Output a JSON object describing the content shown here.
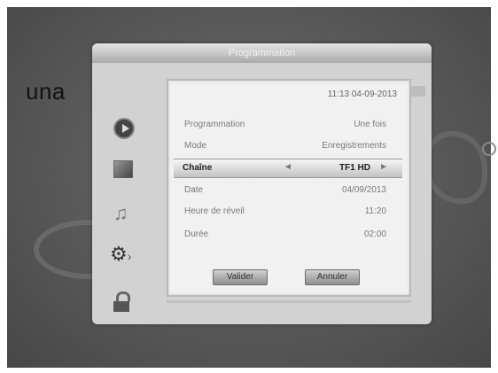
{
  "overlay_text": "una",
  "window": {
    "title": "Programmation"
  },
  "sidebar": {
    "icons": [
      "play-icon",
      "picture-icon",
      "music-icon",
      "tools-icon",
      "lock-icon"
    ]
  },
  "panel": {
    "datetime": "11:13 04-09-2013",
    "rows": [
      {
        "label": "Programmation",
        "value": "Une fois"
      },
      {
        "label": "Mode",
        "value": "Enregistrements"
      },
      {
        "label": "Chaîne",
        "value": "TF1 HD"
      },
      {
        "label": "Date",
        "value": "04/09/2013"
      },
      {
        "label": "Heure de réveil",
        "value": "11:20"
      },
      {
        "label": "Durée",
        "value": "02:00"
      }
    ],
    "arrows": {
      "left": "◄",
      "right": "►"
    },
    "buttons": {
      "validate": "Valider",
      "cancel": "Annuler"
    }
  },
  "colors": {
    "selected_row": "#c2c2c2",
    "panel_background": "#f1f1f1"
  }
}
